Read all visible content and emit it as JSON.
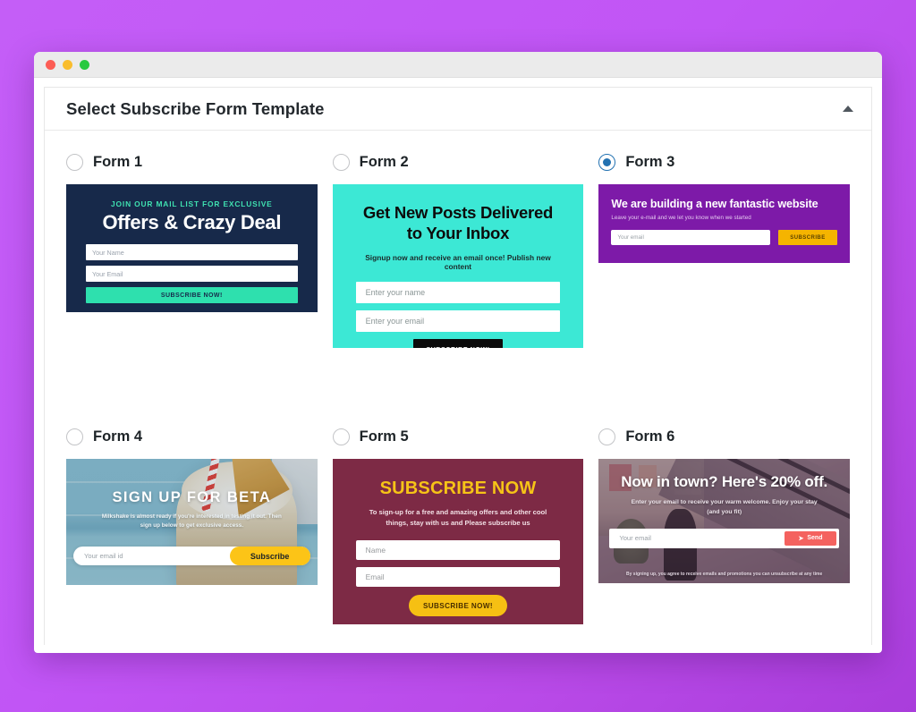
{
  "window": {
    "traffic_lights": [
      "close",
      "minimize",
      "maximize"
    ]
  },
  "panel": {
    "title": "Select Subscribe Form Template",
    "collapse_icon": "caret-up-icon"
  },
  "selected_form": "Form 3",
  "forms": [
    {
      "id": "form-1",
      "radio_label": "Form 1",
      "selected": false,
      "accent": "#2ee0ae",
      "background": "#17294a",
      "eyebrow": "JOIN OUR MAIL LIST FOR EXCLUSIVE",
      "heading": "Offers & Crazy Deal",
      "fields": [
        {
          "placeholder": "Your Name"
        },
        {
          "placeholder": "Your Email"
        }
      ],
      "button": "SUBSCRIBE NOW!"
    },
    {
      "id": "form-2",
      "radio_label": "Form 2",
      "selected": false,
      "accent": "#0b0b0b",
      "background": "#3ce8d5",
      "heading": "Get New  Posts Delivered to Your Inbox",
      "subheading": "Signup now and receive an email once! Publish new content",
      "fields": [
        {
          "placeholder": "Enter your name"
        },
        {
          "placeholder": "Enter your email"
        }
      ],
      "button": "SUBSCRIBE NOW!"
    },
    {
      "id": "form-3",
      "radio_label": "Form 3",
      "selected": true,
      "accent": "#f5b400",
      "background": "#7d1aa8",
      "heading": "We are building a new fantastic website",
      "subheading": "Leave your e-mail and we let you know when we started",
      "fields": [
        {
          "placeholder": "Your email"
        }
      ],
      "button": "SUBSCRIBE"
    },
    {
      "id": "form-4",
      "radio_label": "Form 4",
      "selected": false,
      "accent": "#fcc417",
      "background": "photo-milkshake",
      "heading": "SIGN UP FOR BETA",
      "subheading": "Milkshake is almost ready if you're interested in testing it out. Then sign up below to get exclusive access.",
      "fields": [
        {
          "placeholder": "Your email id"
        }
      ],
      "button": "Subscribe"
    },
    {
      "id": "form-5",
      "radio_label": "Form 5",
      "selected": false,
      "accent": "#f6c013",
      "background": "#7d2a45",
      "heading": "SUBSCRIBE NOW",
      "subheading": "To sign-up for a free and amazing offers and other cool things, stay with us and Please subscribe us",
      "fields": [
        {
          "placeholder": "Name"
        },
        {
          "placeholder": "Email"
        }
      ],
      "button": "SUBSCRIBE NOW!"
    },
    {
      "id": "form-6",
      "radio_label": "Form 6",
      "selected": false,
      "accent": "#f4625f",
      "background": "photo-mall-escalator",
      "heading": "Now in town? Here's 20% off.",
      "subheading": "Enter your email to receive your warm welcome. Enjoy your stay (and you fit)",
      "fields": [
        {
          "placeholder": "Your email"
        }
      ],
      "button": "Send",
      "button_icon": "paper-plane-icon",
      "fine_print": "By signing up, you agree to receive emails and promotions you can unsubscribe at any time"
    }
  ],
  "colors": {
    "page_background": "#c455f5",
    "radio_selected": "#2271b1",
    "panel_title": "#23282d"
  }
}
